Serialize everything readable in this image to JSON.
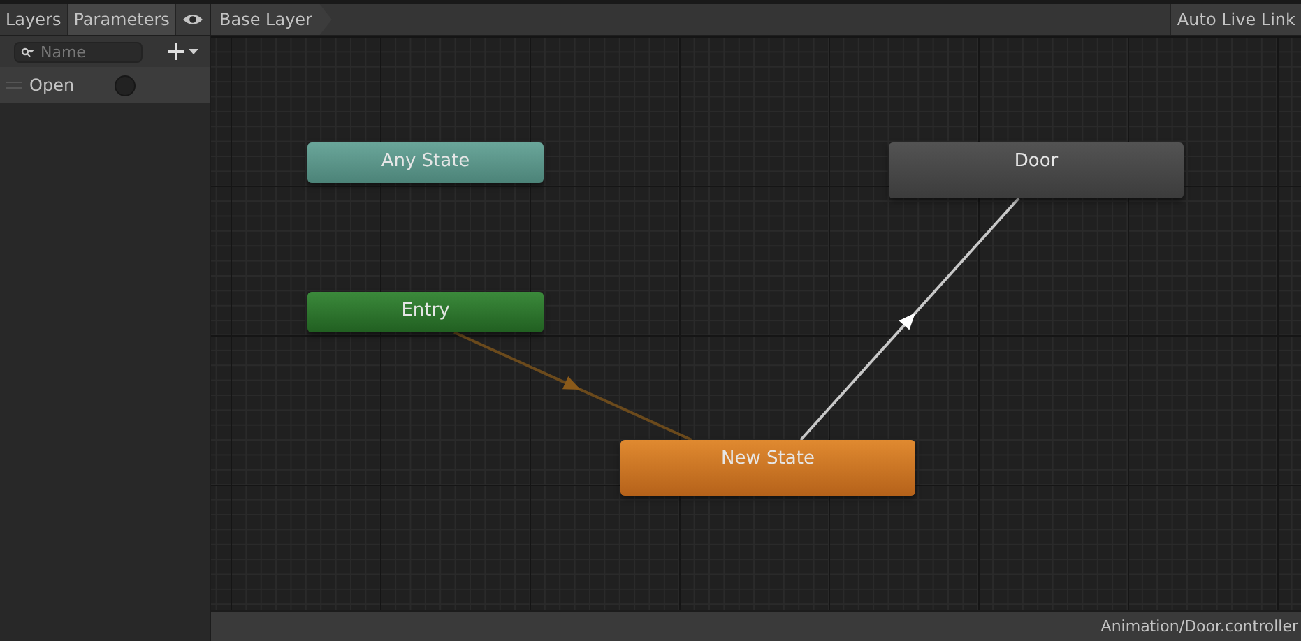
{
  "tabs": [
    {
      "label": "Layers",
      "selected": false
    },
    {
      "label": "Parameters",
      "selected": true
    }
  ],
  "search": {
    "placeholder": "Name"
  },
  "parameters": [
    {
      "name": "Open",
      "kind": "trigger",
      "value": false
    }
  ],
  "breadcrumb": "Base Layer",
  "live_link": {
    "label": "Auto Live Link",
    "on": false
  },
  "nodes": [
    {
      "label": "Any State",
      "kind": "any"
    },
    {
      "label": "Entry",
      "kind": "entry"
    },
    {
      "label": "New State",
      "kind": "default"
    },
    {
      "label": "Door",
      "kind": "state"
    }
  ],
  "transitions": [
    {
      "kind": "entry"
    },
    {
      "kind": "state"
    }
  ],
  "status_bar": "Animation/Door.controller"
}
